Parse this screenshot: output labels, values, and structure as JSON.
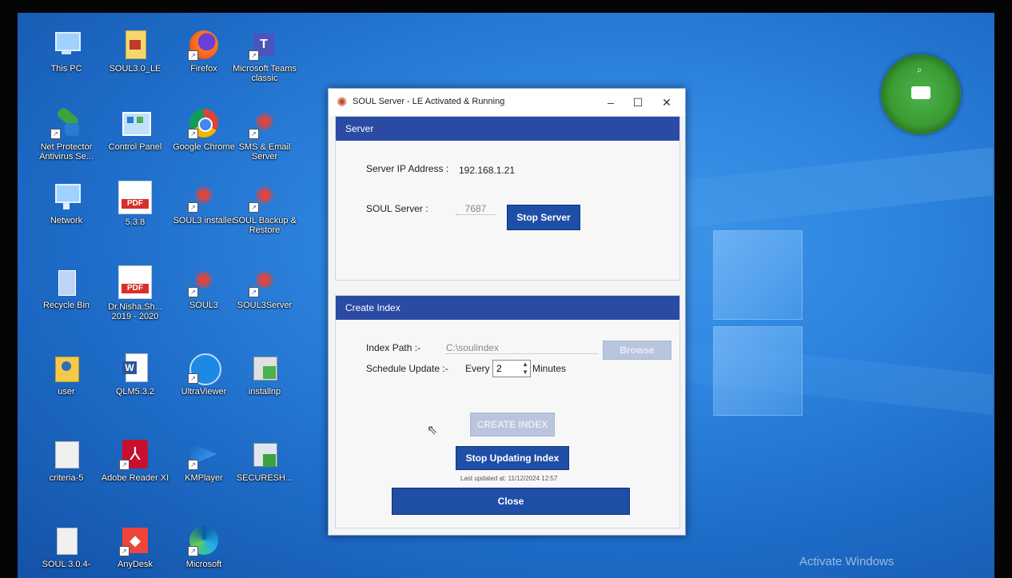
{
  "desktop": {
    "icons": [
      {
        "label": "This PC"
      },
      {
        "label": "SOUL3.0_LE"
      },
      {
        "label": "Firefox"
      },
      {
        "label": "Microsoft Teams classic"
      },
      {
        "label": "Net Protector Antivirus Se..."
      },
      {
        "label": "Control Panel"
      },
      {
        "label": "Google Chrome"
      },
      {
        "label": "SMS & Email Server"
      },
      {
        "label": "Network"
      },
      {
        "label": "5.3.8"
      },
      {
        "label": "SOUL3 installer"
      },
      {
        "label": "SOUL Backup & Restore"
      },
      {
        "label": "Recycle Bin"
      },
      {
        "label": "Dr.Nisha.Sh... 2019 - 2020"
      },
      {
        "label": "SOUL3"
      },
      {
        "label": "SOUL3Server"
      },
      {
        "label": "user"
      },
      {
        "label": "QLM5.3.2"
      },
      {
        "label": "UltraViewer"
      },
      {
        "label": "installnp"
      },
      {
        "label": "criteria-5"
      },
      {
        "label": "Adobe Reader XI"
      },
      {
        "label": "KMPlayer"
      },
      {
        "label": "SECURESH..."
      },
      {
        "label": "SOUL 3.0.4-"
      },
      {
        "label": "AnyDesk"
      },
      {
        "label": "Microsoft"
      }
    ],
    "watermark": "Activate Windows",
    "pdf_badge": "PDF"
  },
  "app": {
    "title": "SOUL Server - LE Activated & Running",
    "minimize": "–",
    "maximize": "☐",
    "close_glyph": "✕",
    "server_section": "Server",
    "ip_label": "Server IP Address :",
    "ip_value": "192.168.1.21",
    "soul_server_label": "SOUL Server :",
    "port_value": "7687",
    "stop_server": "Stop Server",
    "index_section": "Create Index",
    "index_path_label": "Index Path :-",
    "index_path_value": "C:\\soulindex",
    "browse": "Browse",
    "schedule_label": "Schedule Update :-",
    "every": "Every",
    "every_value": "2",
    "minutes": "Minutes",
    "create_index": "CREATE INDEX",
    "stop_updating": "Stop Updating Index",
    "last_updated": "Last updated at: 11/12/2024 12:57",
    "close": "Close"
  },
  "colors": {
    "accent": "#2a4aa3",
    "button": "#1f4ea6",
    "desktop": "#2f86e0"
  }
}
